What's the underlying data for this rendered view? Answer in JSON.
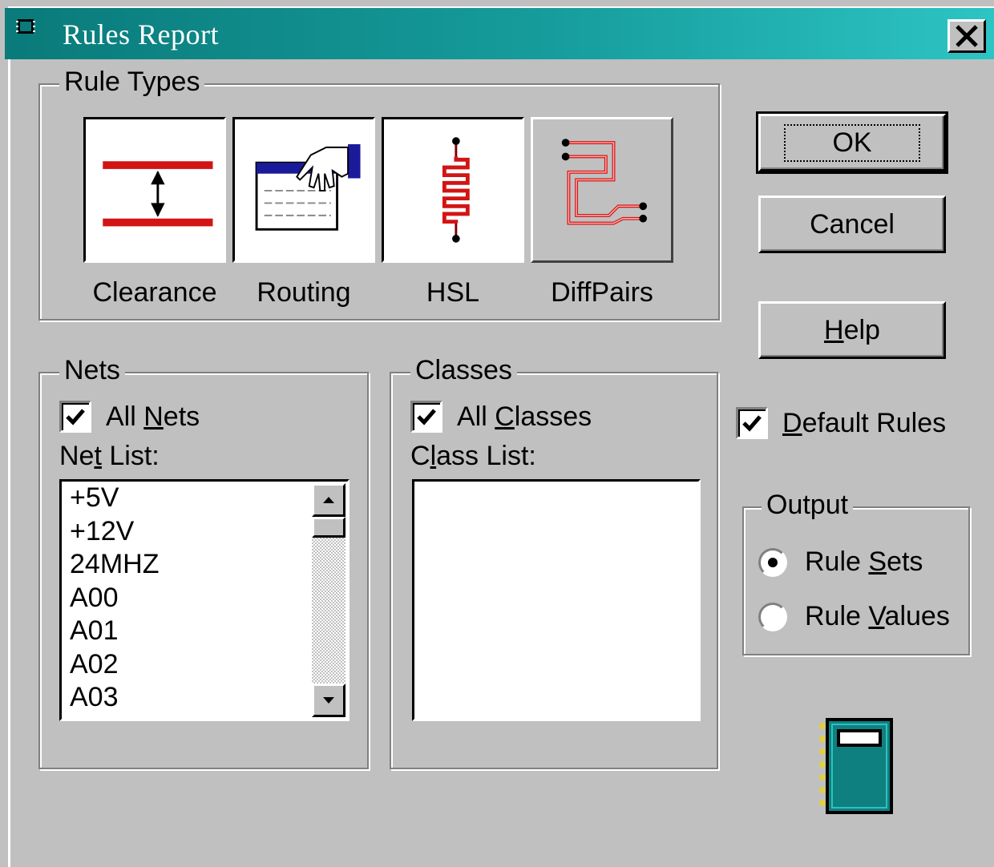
{
  "window": {
    "title": "Rules Report",
    "close_label": "✕",
    "title_bar_color": "#169c9c"
  },
  "rule_types": {
    "legend": "Rule Types",
    "tiles": [
      {
        "label": "Clearance",
        "icon": "clearance-icon",
        "selected": false
      },
      {
        "label": "Routing",
        "icon": "routing-icon",
        "selected": false
      },
      {
        "label": "HSL",
        "icon": "hsl-icon",
        "selected": false
      },
      {
        "label": "DiffPairs",
        "icon": "diffpairs-icon",
        "selected": true
      }
    ]
  },
  "buttons": {
    "ok": "OK",
    "cancel": "Cancel",
    "help_mnemonic": "H",
    "help_rest": "elp"
  },
  "nets": {
    "legend": "Nets",
    "all_checkbox": {
      "pre": "All ",
      "mnemonic": "N",
      "post": "ets",
      "checked": true
    },
    "list_label": {
      "pre": "Ne",
      "mnemonic": "t",
      "post": " List:"
    },
    "items": [
      "+5V",
      "+12V",
      "24MHZ",
      "A00",
      "A01",
      "A02",
      "A03"
    ]
  },
  "classes": {
    "legend": "Classes",
    "all_checkbox": {
      "pre": "All ",
      "mnemonic": "C",
      "post": "lasses",
      "checked": true
    },
    "list_label": {
      "pre": "C",
      "mnemonic": "l",
      "post": "ass List:"
    },
    "items": []
  },
  "default_rules": {
    "pre": "",
    "mnemonic": "D",
    "post": "efault Rules",
    "checked": true
  },
  "output": {
    "legend": "Output",
    "options": [
      {
        "pre": "Rule ",
        "mnemonic": "S",
        "post": "ets",
        "selected": true
      },
      {
        "pre": "Rule ",
        "mnemonic": "V",
        "post": "alues",
        "selected": false
      }
    ]
  },
  "colors": {
    "trace_red": "#d21414",
    "accent_teal": "#0f8080"
  }
}
